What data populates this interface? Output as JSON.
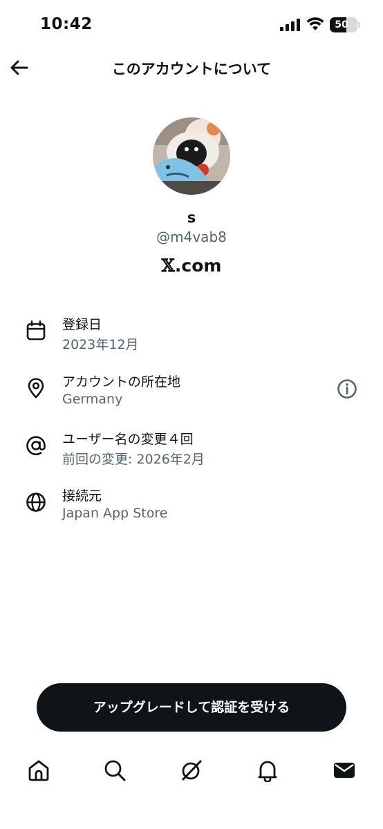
{
  "status_bar": {
    "time": "10:42",
    "battery": "50"
  },
  "header": {
    "title": "このアカウントについて"
  },
  "profile": {
    "name": "s",
    "handle": "@m4vab8",
    "site_mark": "𝕏",
    "site_rest": ".com"
  },
  "details": [
    {
      "icon": "calendar-icon",
      "label": "登録日",
      "value": "2023年12月"
    },
    {
      "icon": "location-pin-icon",
      "label": "アカウントの所在地",
      "value": "Germany"
    },
    {
      "icon": "at-sign-icon",
      "label": "ユーザー名の変更４回",
      "value": "前回の変更: 2026年2月"
    },
    {
      "icon": "globe-icon",
      "label": "接続元",
      "value": "Japan App Store"
    }
  ],
  "cta": {
    "label": "アップグレードして認証を受ける"
  },
  "tabbar": [
    "home-icon",
    "search-icon",
    "grok-icon",
    "notifications-bell-icon",
    "messages-envelope-icon"
  ]
}
